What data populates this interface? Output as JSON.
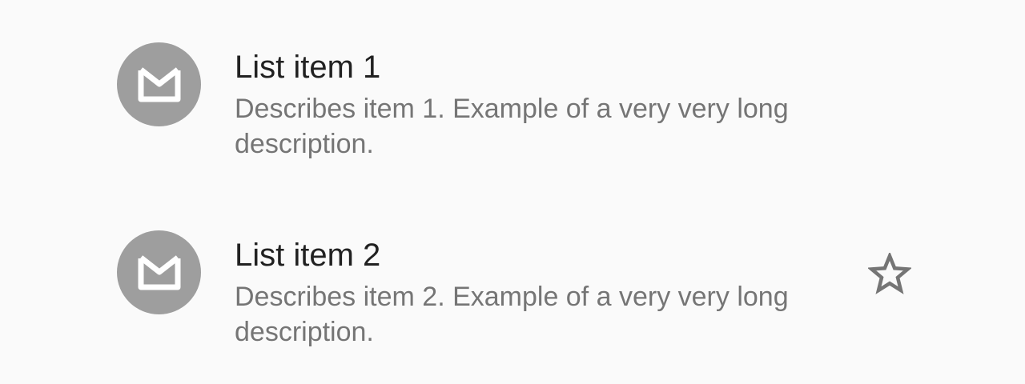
{
  "list": {
    "items": [
      {
        "title": "List item 1",
        "description": "Describes item 1. Example of a very very long description.",
        "avatar_icon": "mail-icon",
        "trailing_icon": null
      },
      {
        "title": "List item 2",
        "description": "Describes item 2. Example of a very very long description.",
        "avatar_icon": "mail-icon",
        "trailing_icon": "star-outline-icon"
      }
    ]
  },
  "colors": {
    "background": "#fafafa",
    "avatar_bg": "#9e9e9e",
    "avatar_icon": "#ffffff",
    "title": "#212121",
    "description": "#757575",
    "star_outline": "#757575"
  }
}
